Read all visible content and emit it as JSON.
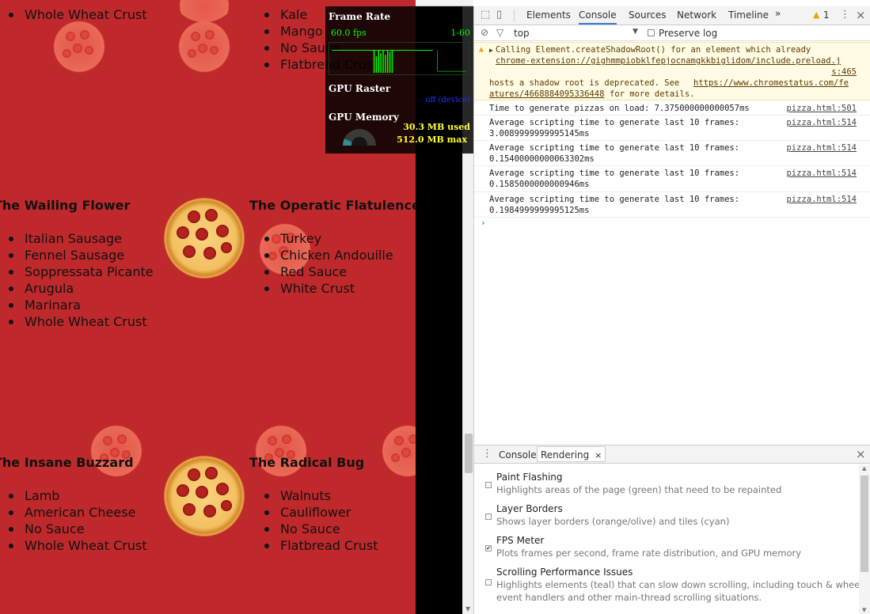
{
  "page": {
    "pizzas": [
      {
        "name": "",
        "ingredients": [
          "Whole Wheat Crust"
        ]
      },
      {
        "name": "",
        "ingredients": [
          "Kale",
          "Mango",
          "No Sauce",
          "Flatbread Crust"
        ]
      },
      {
        "name": "The Wailing Flower",
        "ingredients": [
          "Italian Sausage",
          "Fennel Sausage",
          "Soppressata Picante",
          "Arugula",
          "Marinara",
          "Whole Wheat Crust"
        ]
      },
      {
        "name": "The Operatic Flatulence",
        "ingredients": [
          "Turkey",
          "Chicken Andouille",
          "Red Sauce",
          "White Crust"
        ]
      },
      {
        "name": "The Insane Buzzard",
        "ingredients": [
          "Lamb",
          "American Cheese",
          "No Sauce",
          "Whole Wheat Crust"
        ]
      },
      {
        "name": "The Radical Bug",
        "ingredients": [
          "Walnuts",
          "Cauliflower",
          "No Sauce",
          "Flatbread Crust"
        ]
      }
    ],
    "background_color": "#c0292b"
  },
  "fps_meter": {
    "frame_rate_label": "Frame Rate",
    "fps_value": "60.0 fps",
    "fps_range": "1-60",
    "gpu_raster_label": "GPU Raster",
    "gpu_raster_status": "off (device)",
    "gpu_memory_label": "GPU Memory",
    "memory_used": "30.3 MB used",
    "memory_max": "512.0 MB max",
    "memory_fraction": 0.06
  },
  "devtools": {
    "tabs": [
      "Elements",
      "Console",
      "Sources",
      "Network",
      "Timeline"
    ],
    "active_tab": "Console",
    "more_icon": "»",
    "warning_count": "1",
    "context": "top",
    "preserve_log": "Preserve log",
    "warning": {
      "l1": "Calling Element.createShadowRoot() for an element which already",
      "l2_link": "chrome-extension://gighmmpiobklfepjocnamgkkbiglidom/include.preload.j",
      "l3_link": "s:465",
      "l4a": "hosts a shadow root is deprecated. See ",
      "l4_link": "https://www.chromestatus.com/fe",
      "l5_link": "atures/4668884095336448",
      "l5b": " for more details."
    },
    "messages": [
      {
        "text": "Time to generate pizzas on load: 7.375000000000057ms",
        "text2": "",
        "source": "pizza.html:501"
      },
      {
        "text": "Average scripting time to generate last 10 frames:",
        "text2": "3.0089999999995145ms",
        "source": "pizza.html:514"
      },
      {
        "text": "Average scripting time to generate last 10 frames:",
        "text2": "0.15400000000063302ms",
        "source": "pizza.html:514"
      },
      {
        "text": "Average scripting time to generate last 10 frames:",
        "text2": "0.1585000000000946ms",
        "source": "pizza.html:514"
      },
      {
        "text": "Average scripting time to generate last 10 frames:",
        "text2": "0.1984999999995125ms",
        "source": "pizza.html:514"
      }
    ],
    "prompt": "›",
    "drawer": {
      "tabs": [
        "Console",
        "Rendering"
      ],
      "close": "×",
      "options": [
        {
          "title": "Paint Flashing",
          "desc": "Highlights areas of the page (green) that need to be repainted",
          "desc2": "",
          "checked": false
        },
        {
          "title": "Layer Borders",
          "desc": "Shows layer borders (orange/olive) and tiles (cyan)",
          "desc2": "",
          "checked": false
        },
        {
          "title": "FPS Meter",
          "desc": "Plots frames per second, frame rate distribution, and GPU memory",
          "desc2": "",
          "checked": true
        },
        {
          "title": "Scrolling Performance Issues",
          "desc": "Highlights elements (teal) that can slow down scrolling, including touch & wheel",
          "desc2": "event handlers and other main-thread scrolling situations.",
          "checked": false
        }
      ]
    }
  }
}
